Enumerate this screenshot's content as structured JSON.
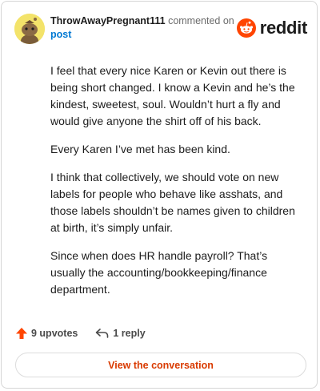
{
  "comment": {
    "username": "ThrowAwayPregnant111",
    "action_text": "commented on",
    "post_link": "post",
    "brand": "reddit",
    "paragraphs": [
      "I feel that every nice Karen or Kevin out there is being short changed. I know a Kevin and he’s the kindest, sweetest, soul. Wouldn’t hurt a fly and would give anyone the shirt off of his back.",
      "Every Karen I’ve met has been kind.",
      "I think that collectively, we should vote on new labels for people who behave like asshats, and those labels shouldn’t be names given to children at birth, it’s simply unfair.",
      "Since when does HR handle payroll? That’s usually the accounting/bookkeeping/finance department."
    ]
  },
  "footer": {
    "upvotes_label": "9 upvotes",
    "replies_label": "1 reply",
    "conversation_button": "View the conversation"
  },
  "colors": {
    "reddit_orange": "#ff4500",
    "link_blue": "#0079d3",
    "button_text": "#d93a00",
    "avatar_yellow": "#f3e36a"
  },
  "icons": [
    "avatar-snoo-icon",
    "reddit-logo-icon",
    "upvote-arrow-icon",
    "reply-arrow-icon"
  ]
}
